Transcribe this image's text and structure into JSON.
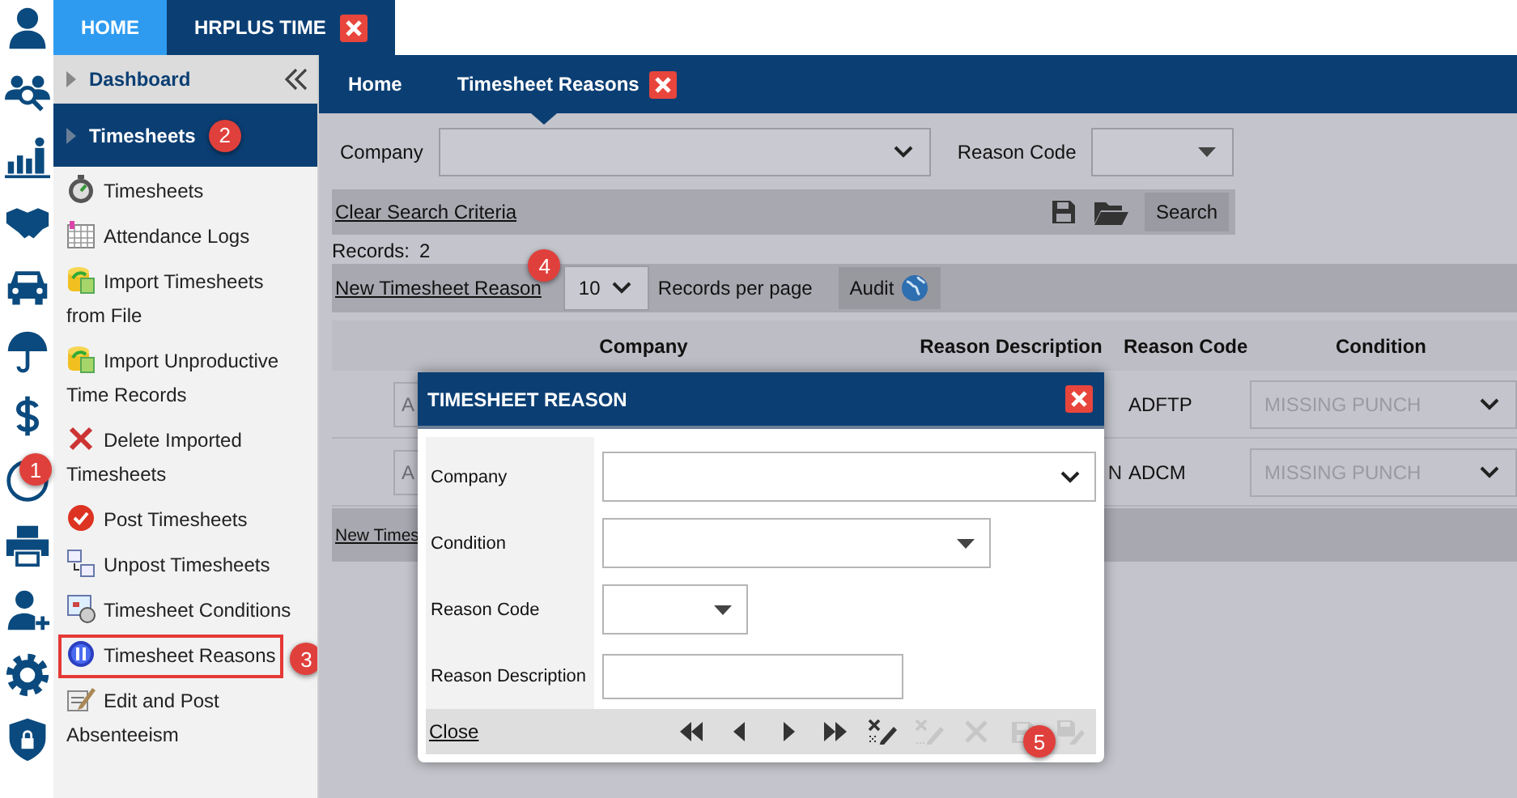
{
  "top_tabs": [
    {
      "label": "HOME",
      "selected": false,
      "closable": false
    },
    {
      "label": "HRPLUS TIME",
      "selected": true,
      "closable": true
    }
  ],
  "rail_callout": "1",
  "sidebar": {
    "header": {
      "label": "Dashboard"
    },
    "section": {
      "label": "Timesheets",
      "callout": "2"
    },
    "items": [
      {
        "label": "Timesheets",
        "highlighted": false
      },
      {
        "label": "Attendance Logs",
        "highlighted": false
      },
      {
        "label": "Import Timesheets from File",
        "highlighted": false
      },
      {
        "label": "Import Unproductive Time Records",
        "highlighted": false
      },
      {
        "label": "Delete Imported Timesheets",
        "highlighted": false
      },
      {
        "label": "Post Timesheets",
        "highlighted": false
      },
      {
        "label": "Unpost Timesheets",
        "highlighted": false
      },
      {
        "label": "Timesheet Conditions",
        "highlighted": false
      },
      {
        "label": "Timesheet Reasons",
        "highlighted": true,
        "callout": "3"
      },
      {
        "label": "Edit and Post Absenteeism",
        "highlighted": false
      }
    ]
  },
  "page_tabs": [
    {
      "label": "Home",
      "selected": false,
      "closable": false
    },
    {
      "label": "Timesheet Reasons",
      "selected": true,
      "closable": true
    }
  ],
  "filters": [
    {
      "label": "Company",
      "kind": "chevron"
    },
    {
      "label": "Reason Code",
      "kind": "caret"
    }
  ],
  "search_bar": {
    "clear_link": "Clear Search Criteria",
    "button": "Search"
  },
  "records": {
    "label": "Records:",
    "count": "2"
  },
  "list_toolbar": {
    "new_link": "New Timesheet Reason",
    "callout": "4",
    "page_size": "10",
    "page_size_label": "Records per page",
    "audit_button": "Audit"
  },
  "table": {
    "columns": [
      "Company",
      "Reason Description",
      "Reason Code",
      "Condition"
    ],
    "rows": [
      {
        "company": "A",
        "reason_code": "ADFTP",
        "condition": "MISSING PUNCH"
      },
      {
        "company": "A",
        "reason_description": "N",
        "reason_code": "ADCM",
        "condition": "MISSING PUNCH"
      }
    ]
  },
  "bottom_link": "New Times",
  "dialog": {
    "title": "TIMESHEET REASON",
    "fields": [
      {
        "label": "Company",
        "kind": "chevron"
      },
      {
        "label": "Condition",
        "kind": "caret"
      },
      {
        "label": "Reason Code",
        "kind": "caret"
      },
      {
        "label": "Reason Description",
        "kind": "text"
      }
    ],
    "close_link": "Close",
    "tools": [
      {
        "disabled": false
      },
      {
        "disabled": false
      },
      {
        "disabled": false
      },
      {
        "disabled": false
      },
      {
        "disabled": false
      },
      {
        "disabled": true
      },
      {
        "disabled": true
      },
      {
        "disabled": true,
        "callout": "5"
      },
      {
        "disabled": true
      }
    ]
  }
}
